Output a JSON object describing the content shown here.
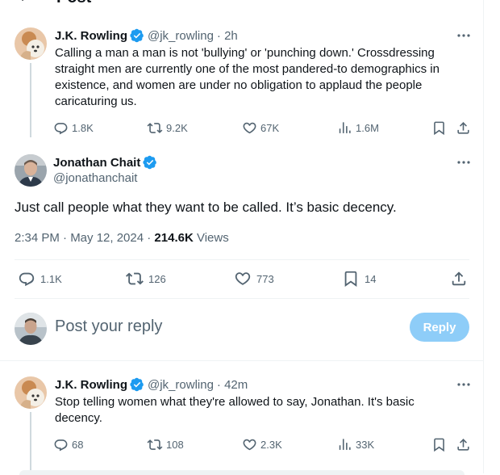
{
  "header": {
    "title": "Post"
  },
  "tweet1": {
    "name": "J.K. Rowling",
    "handle": "@jk_rowling",
    "time": "· 2h",
    "text": "Calling a man a man is not 'bullying' or 'punching down.' Crossdressing straight men are currently one of the most pandered-to demographics in existence, and women are under no obligation to applaud the people caricaturing us.",
    "replies": "1.8K",
    "reposts": "9.2K",
    "likes": "67K",
    "views": "1.6M"
  },
  "main_tweet": {
    "name": "Jonathan Chait",
    "handle": "@jonathanchait",
    "text": "Just call people what they want to be called. It’s basic decency.",
    "timestamp": "2:34 PM · May 12, 2024 · ",
    "views_count": "214.6K",
    "views_label": " Views",
    "replies": "1.1K",
    "reposts": "126",
    "likes": "773",
    "bookmarks": "14"
  },
  "composer": {
    "placeholder": "Post your reply",
    "button": "Reply"
  },
  "tweet3": {
    "name": "J.K. Rowling",
    "handle": "@jk_rowling",
    "time": "· 42m",
    "text": "Stop telling women what they're allowed to say, Jonathan. It's basic decency.",
    "replies": "68",
    "reposts": "108",
    "likes": "2.3K",
    "views": "33K"
  },
  "colors": {
    "accent": "#1d9bf0",
    "reply_button_disabled": "#8ecdf8",
    "muted_text": "#536471",
    "divider": "#eff3f4"
  }
}
